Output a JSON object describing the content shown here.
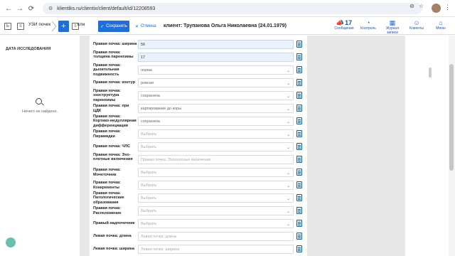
{
  "browser": {
    "url": "klientiks.ru/clientix/client/default/id/12208593"
  },
  "toolbar": {
    "tab_label": "УЗИ почек",
    "tab2_label": "кли",
    "save_label": "Сохранить",
    "cancel_label": "Отмена",
    "client_title": "клиент: Трупанова Ольга Николаевна (24.01.1979)"
  },
  "actions": [
    {
      "label": "Сообщения",
      "count": "17",
      "icon": "megaphone-icon"
    },
    {
      "label": "Контроль",
      "icon": "gauge-icon"
    },
    {
      "label": "Журнал записи",
      "icon": "calendar-icon"
    },
    {
      "label": "Клиенты",
      "icon": "user-icon"
    },
    {
      "label": "Меню",
      "icon": "menu-icon"
    }
  ],
  "left_panel": {
    "title": "ДАТА ИССЛЕДОВАНИЯ",
    "empty_text": "Ничего не найдено."
  },
  "rows": [
    {
      "label": "Правая почка: ширина",
      "value": "56",
      "kind": "filled",
      "select": false
    },
    {
      "label": "Правая почка: толщина паренхимы",
      "value": "17",
      "kind": "filled",
      "select": false
    },
    {
      "label": "Правая почка: дыхательная подвижность",
      "value": "норма",
      "kind": "value",
      "select": true
    },
    {
      "label": "Правая почка: контур",
      "value": "ровная",
      "kind": "value",
      "select": true
    },
    {
      "label": "Правая почка: эхоструктура паренхимы",
      "value": "сохранена",
      "kind": "value",
      "select": true
    },
    {
      "label": "Правая почка: при ЦДК",
      "value": "картирование до коры",
      "kind": "value",
      "select": true
    },
    {
      "label": "Правая почка: Кортико-медуллярная дифференциация",
      "value": "сохранена",
      "kind": "value",
      "select": true
    },
    {
      "label": "Правая почка: Пирамидки",
      "value": "Выбрать",
      "kind": "placeholder",
      "select": true
    },
    {
      "label": "Правая почка: ЧЛС",
      "value": "Выбрать",
      "kind": "placeholder",
      "select": true
    },
    {
      "label": "Правая почка: Эхо-плотные включения",
      "value": "Правая почка: Эхоплотные включения",
      "kind": "placeholder",
      "select": false
    },
    {
      "label": "Правая почка: Мочеточник",
      "value": "Выбрать",
      "kind": "placeholder",
      "select": true
    },
    {
      "label": "Правая почка: Конкременты",
      "value": "Выбрать",
      "kind": "placeholder",
      "select": true
    },
    {
      "label": "Правая почка: Патологические образования",
      "value": "Выбрать",
      "kind": "placeholder",
      "select": true
    },
    {
      "label": "Правая почка: Расположение",
      "value": "Выбрать",
      "kind": "placeholder",
      "select": true
    },
    {
      "label": "Правый надпочечник",
      "value": "Выбрать",
      "kind": "placeholder",
      "select": true
    },
    {
      "label": "Левая почка: длина",
      "value": "Левая почка: длина",
      "kind": "placeholder",
      "select": false
    },
    {
      "label": "Левая почка: ширина",
      "value": "Левая почка: ширина",
      "kind": "placeholder",
      "select": false
    }
  ]
}
